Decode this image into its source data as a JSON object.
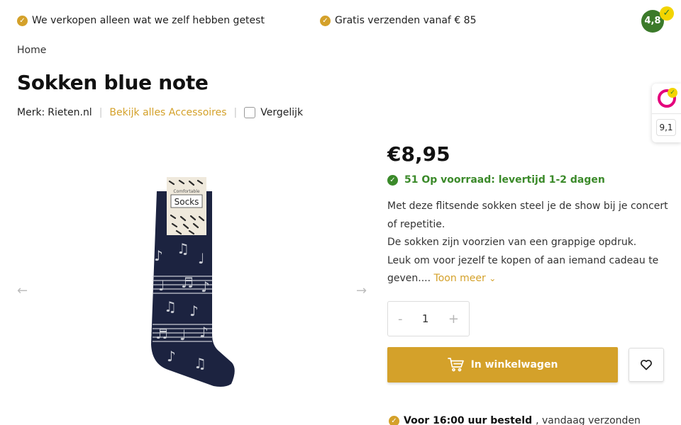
{
  "usp": {
    "items": [
      "We verkopen alleen wat we zelf hebben getest",
      "Gratis verzenden vanaf € 85"
    ]
  },
  "rating_badge": {
    "score": "4,8"
  },
  "side_widget": {
    "score": "9,1"
  },
  "breadcrumb": {
    "home": "Home"
  },
  "product": {
    "title": "Sokken blue note",
    "brand_label": "Merk:",
    "brand": "Rieten.nl",
    "all_link": "Bekijk alles Accessoires",
    "compare_label": "Vergelijk",
    "price": "€8,95",
    "stock": "51 Op voorraad: levertijd 1-2 dagen",
    "description": [
      "Met deze flitsende sokken steel je de show bij je concert of repetitie.",
      "De sokken zijn voorzien van een grappige opdruk.",
      "Leuk om voor jezelf te kopen of aan iemand cadeau te geven...."
    ],
    "more_label": "Toon meer",
    "quantity": "1",
    "qty_minus": "-",
    "qty_plus": "+",
    "cart_label": "In winkelwagen",
    "sock_label_top": "Comfortable",
    "sock_label_main": "Socks"
  },
  "shipping": {
    "bold": "Voor 16:00 uur besteld",
    "rest": ", vandaag verzonden"
  },
  "colors": {
    "accent": "#d4a12a",
    "stock_green": "#3b8a2a",
    "sock_navy": "#1c2340"
  }
}
